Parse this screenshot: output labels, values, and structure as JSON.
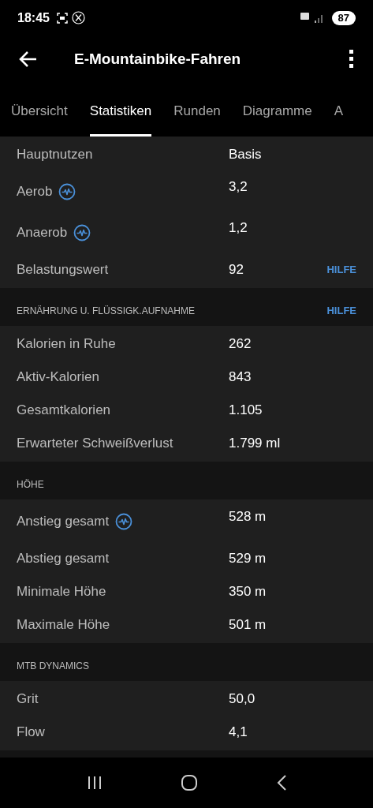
{
  "status_bar": {
    "time": "18:45",
    "battery": "87"
  },
  "header": {
    "title": "E-Mountainbike-Fahren"
  },
  "tabs": [
    {
      "label": "Übersicht",
      "selected": false
    },
    {
      "label": "Statistiken",
      "selected": true
    },
    {
      "label": "Runden",
      "selected": false
    },
    {
      "label": "Diagramme",
      "selected": false
    },
    {
      "label": "A",
      "selected": false
    }
  ],
  "sections": [
    {
      "rows": [
        {
          "label": "Hauptnutzen",
          "value": "Basis",
          "info": false
        },
        {
          "label": "Aerob",
          "value": "3,2",
          "info": true
        },
        {
          "label": "Anaerob",
          "value": "1,2",
          "info": true
        },
        {
          "label": "Belastungswert",
          "value": "92",
          "info": false,
          "help": "HILFE"
        }
      ]
    },
    {
      "title": "ERNÄHRUNG U. FLÜSSIGK.AUFNAHME",
      "help": "HILFE",
      "rows": [
        {
          "label": "Kalorien in Ruhe",
          "value": "262",
          "info": false
        },
        {
          "label": "Aktiv-Kalorien",
          "value": "843",
          "info": false
        },
        {
          "label": "Gesamtkalorien",
          "value": "1.105",
          "info": false
        },
        {
          "label": "Erwarteter Schweißverlust",
          "value": "1.799 ml",
          "info": false
        }
      ]
    },
    {
      "title": "HÖHE",
      "rows": [
        {
          "label": "Anstieg gesamt",
          "value": "528 m",
          "info": true
        },
        {
          "label": "Abstieg gesamt",
          "value": "529 m",
          "info": false
        },
        {
          "label": "Minimale Höhe",
          "value": "350 m",
          "info": false
        },
        {
          "label": "Maximale Höhe",
          "value": "501 m",
          "info": false
        }
      ]
    },
    {
      "title": "MTB DYNAMICS",
      "rows": [
        {
          "label": "Grit",
          "value": "50,0",
          "info": false
        },
        {
          "label": "Flow",
          "value": "4,1",
          "info": false
        }
      ]
    }
  ]
}
